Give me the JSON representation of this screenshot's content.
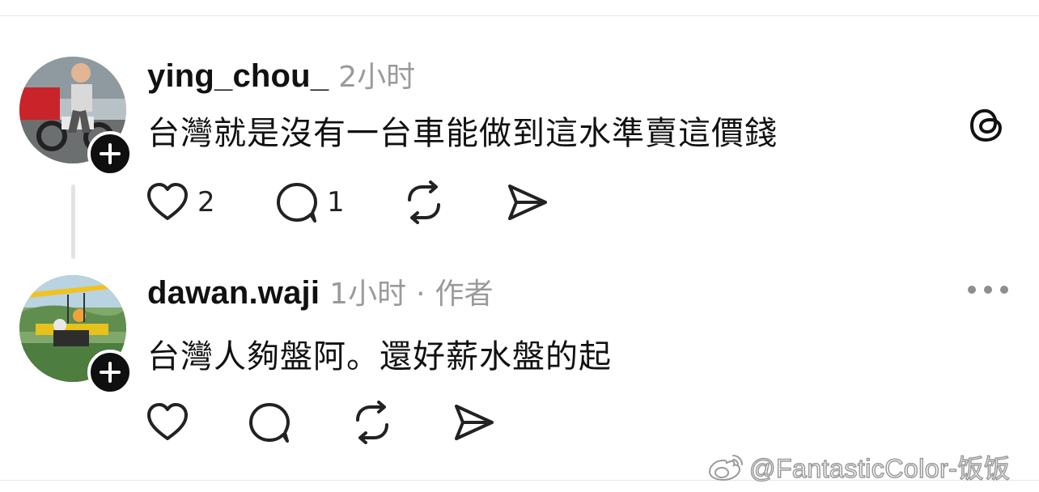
{
  "comments": [
    {
      "username": "ying_chou_",
      "time": "2小时",
      "text": "台灣就是沒有一台車能做到這水準賣這價錢",
      "like_count": "2",
      "reply_count": "1"
    },
    {
      "username": "dawan.waji",
      "time": "1小时",
      "separator": "·",
      "author_tag": "作者",
      "text": "台灣人夠盤阿。還好薪水盤的起"
    }
  ],
  "icons": {
    "like": "heart-icon",
    "reply": "comment-icon",
    "repost": "repost-icon",
    "share": "send-icon",
    "follow": "plus-icon",
    "logo": "threads-logo-icon",
    "menu": "more-icon"
  },
  "watermark": {
    "text": "@FantasticColor-饭饭"
  },
  "colors": {
    "text": "#111111",
    "muted": "#9a9a9a",
    "badge": "#0f0f0f",
    "divider": "#e6e6e6"
  }
}
